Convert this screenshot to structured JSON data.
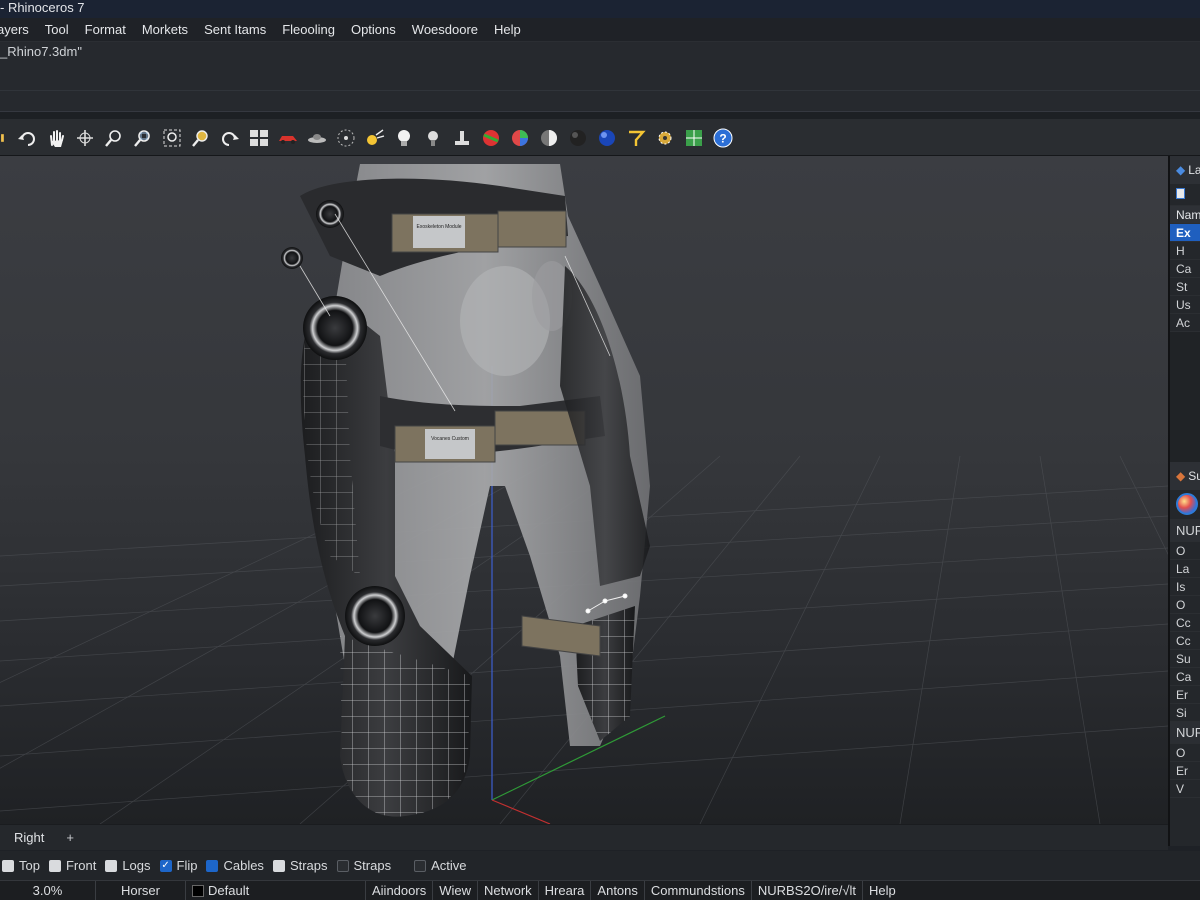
{
  "window": {
    "title": "- Rhinoceros 7"
  },
  "menu": [
    "ayers",
    "Tool",
    "Format",
    "Morkets",
    "Sent Itams",
    "Fleooling",
    "Options",
    "Woesdoore",
    "Help"
  ],
  "command": {
    "file_line": "_Rhino7.3dm\""
  },
  "toolbar": {
    "icons": [
      "layer-icon",
      "undo-icon",
      "pan-hand-icon",
      "rotate-view-icon",
      "zoom-icon",
      "zoom-window-icon",
      "zoom-extents-icon",
      "zoom-selected-icon",
      "redo-view-icon",
      "four-viewports-icon",
      "render-car-icon",
      "ufo-icon",
      "target-icon",
      "spotlight-icon",
      "light-bulb-icon",
      "bulb-off-icon",
      "stamp-icon",
      "material-ball-icon",
      "color-wheel-icon",
      "shaded-sphere-icon",
      "dark-sphere-icon",
      "blue-sphere-icon",
      "curve-tool-icon",
      "gear-settings-icon",
      "grid-snap-icon",
      "help-icon"
    ]
  },
  "right_panel": {
    "layers_header": "La",
    "new_icon_label": "",
    "column_name": "Nam",
    "layers": [
      "Ex",
      "H",
      "Ca",
      "St",
      "Us",
      "Ac"
    ],
    "props_header": "Su",
    "section1": "NUR",
    "props1": [
      "O",
      "La",
      "Is",
      "O",
      "Cc",
      "Cc",
      "Su",
      "Ca",
      "Er",
      "Si"
    ],
    "section2": "NUR",
    "props2": [
      "O",
      "Er",
      "V"
    ]
  },
  "viewport_tabs": {
    "active": "Right",
    "add": "+"
  },
  "osnaps": [
    {
      "label": "Top",
      "state": "off"
    },
    {
      "label": "Front",
      "state": "off"
    },
    {
      "label": "Logs",
      "state": "off"
    },
    {
      "label": "Flip",
      "state": "on"
    },
    {
      "label": "Cables",
      "state": "blue"
    },
    {
      "label": "Straps",
      "state": "off"
    },
    {
      "label": "Straps",
      "state": "dark"
    },
    {
      "label": "Active",
      "state": "dark"
    }
  ],
  "status": {
    "coord": "3.0%",
    "unit": "Horser",
    "layer": "Default",
    "panes": [
      "Aiindoors",
      "Wiew",
      "Network",
      "Hreara",
      "Antons",
      "Commundstions",
      "NURBS2O/ire/√lt",
      "Help"
    ]
  },
  "labels": {
    "hip_plate": "Exoskeleton Module",
    "thigh_plate": "Vocanes Custom"
  },
  "colors": {
    "accent": "#1f5fbf",
    "strap": "#7d735f",
    "shell": "#2b2c2f"
  }
}
